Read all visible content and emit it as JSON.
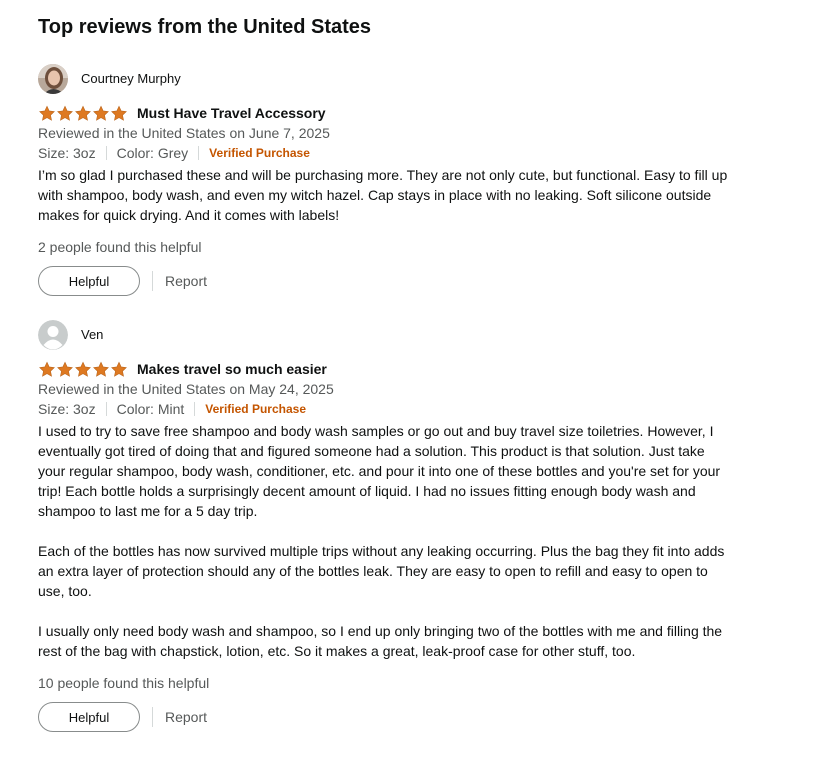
{
  "section_title": "Top reviews from the United States",
  "colors": {
    "star": "#de7921",
    "verified": "#c45500",
    "text": "#0f1111",
    "muted": "#565959"
  },
  "reviews": [
    {
      "author": "Courtney Murphy",
      "avatar": "photo",
      "rating": 5,
      "title": "Must Have Travel Accessory",
      "date": "Reviewed in the United States on June 7, 2025",
      "size": "Size: 3oz",
      "color": "Color: Grey",
      "verified": "Verified Purchase",
      "paragraphs": [
        "I’m so glad I purchased these and will be purchasing more. They are not only cute, but functional. Easy to fill up with shampoo, body wash, and even my witch hazel. Cap stays in place with no leaking. Soft silicone outside makes for quick drying. And it comes with labels!"
      ],
      "helpful_text": "2 people found this helpful",
      "helpful_button": "Helpful",
      "report_link": "Report"
    },
    {
      "author": "Ven",
      "avatar": "default-avatar-icon",
      "rating": 5,
      "title": "Makes travel so much easier",
      "date": "Reviewed in the United States on May 24, 2025",
      "size": "Size: 3oz",
      "color": "Color: Mint",
      "verified": "Verified Purchase",
      "paragraphs": [
        "I used to try to save free shampoo and body wash samples or go out and buy travel size toiletries. However, I eventually got tired of doing that and figured someone had a solution. This product is that solution. Just take your regular shampoo, body wash, conditioner, etc. and pour it into one of these bottles and you're set for your trip! Each bottle holds a surprisingly decent amount of liquid. I had no issues fitting enough body wash and shampoo to last me for a 5 day trip.",
        "Each of the bottles has now survived multiple trips without any leaking occurring. Plus the bag they fit into adds an extra layer of protection should any of the bottles leak. They are easy to open to refill and easy to open to use, too.",
        "I usually only need body wash and shampoo, so I end up only bringing two of the bottles with me and filling the rest of the bag with chapstick, lotion, etc. So it makes a great, leak-proof case for other stuff, too."
      ],
      "helpful_text": "10 people found this helpful",
      "helpful_button": "Helpful",
      "report_link": "Report"
    }
  ]
}
